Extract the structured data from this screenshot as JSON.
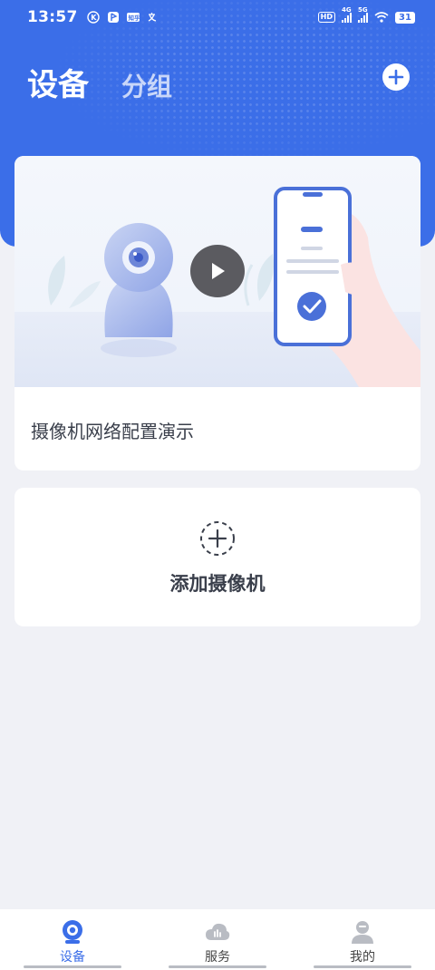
{
  "status_bar": {
    "time": "13:57",
    "hd_label": "HD",
    "net1": "4G",
    "net2": "5G",
    "battery": "31"
  },
  "header": {
    "tab_active": "设备",
    "tab_inactive": "分组",
    "add_icon": "plus-circle-icon"
  },
  "demo_card": {
    "caption": "摄像机网络配置演示",
    "play_icon": "play-icon"
  },
  "add_card": {
    "label": "添加摄像机",
    "icon": "dashed-plus-icon"
  },
  "bottom_nav": {
    "items": [
      {
        "label": "设备",
        "icon": "camera-icon",
        "active": true
      },
      {
        "label": "服务",
        "icon": "cloud-icon",
        "active": false
      },
      {
        "label": "我的",
        "icon": "user-icon",
        "active": false
      }
    ]
  },
  "colors": {
    "accent": "#3b6ee8",
    "background": "#f0f1f6",
    "text": "#3a3f4b"
  }
}
